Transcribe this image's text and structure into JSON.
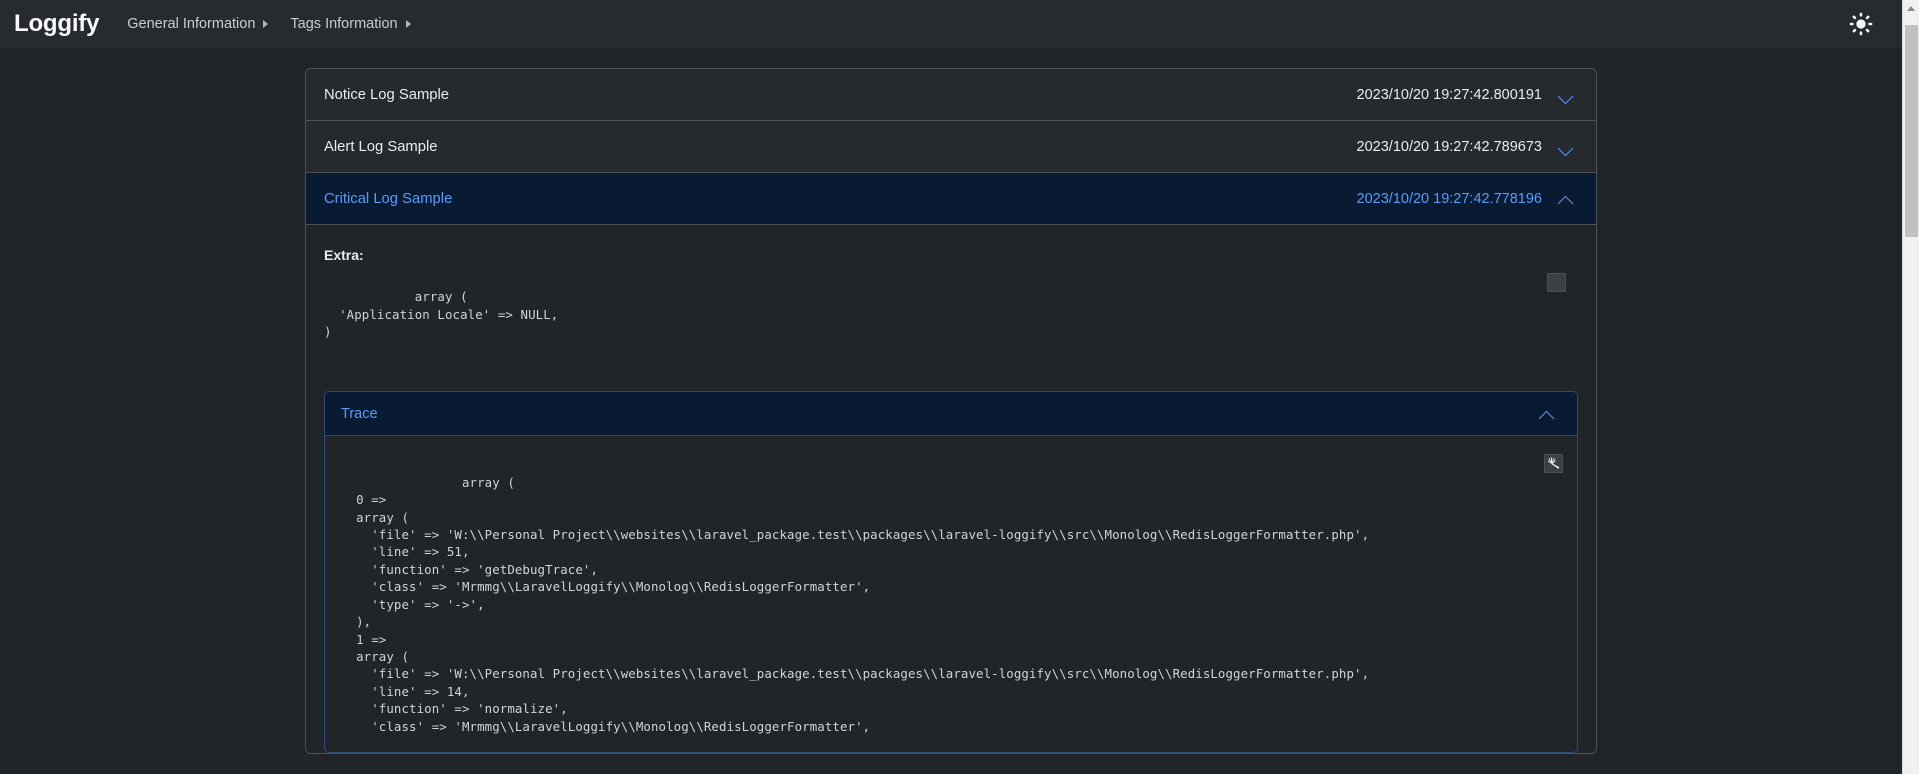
{
  "header": {
    "brand": "Loggify",
    "nav_items": [
      {
        "label": "General Information",
        "icon": "caret-right-icon"
      },
      {
        "label": "Tags Information",
        "icon": "caret-right-icon"
      }
    ],
    "theme_toggle_icon": "sun-icon"
  },
  "accordion": {
    "entries": [
      {
        "title": "Notice Log Sample",
        "timestamp": "2023/10/20 19:27:42.800191",
        "expanded": false,
        "chevron": "chevron-down-icon"
      },
      {
        "title": "Alert Log Sample",
        "timestamp": "2023/10/20 19:27:42.789673",
        "expanded": false,
        "chevron": "chevron-down-icon"
      },
      {
        "title": "Critical Log Sample",
        "timestamp": "2023/10/20 19:27:42.778196",
        "expanded": true,
        "chevron": "chevron-up-icon"
      }
    ]
  },
  "detail": {
    "extra_label": "Extra:",
    "extra_code": "array (\n  'Application Locale' => NULL,\n)",
    "extra_copy_icon": "copy-image-icon",
    "trace": {
      "title": "Trace",
      "chevron": "chevron-up-icon",
      "copy_icon": "copy-image-icon",
      "code": "array (\n  0 => \n  array (\n    'file' => 'W:\\\\Personal Project\\\\websites\\\\laravel_package.test\\\\packages\\\\laravel-loggify\\\\src\\\\Monolog\\\\RedisLoggerFormatter.php',\n    'line' => 51,\n    'function' => 'getDebugTrace',\n    'class' => 'Mrmmg\\\\LaravelLoggify\\\\Monolog\\\\RedisLoggerFormatter',\n    'type' => '->',\n  ),\n  1 => \n  array (\n    'file' => 'W:\\\\Personal Project\\\\websites\\\\laravel_package.test\\\\packages\\\\laravel-loggify\\\\src\\\\Monolog\\\\RedisLoggerFormatter.php',\n    'line' => 14,\n    'function' => 'normalize',\n    'class' => 'Mrmmg\\\\LaravelLoggify\\\\Monolog\\\\RedisLoggerFormatter',"
    }
  },
  "scrollbar": {
    "up_arrow_icon": "scroll-up-arrow-icon"
  },
  "colors": {
    "page_bg": "#212529",
    "navbar_bg": "#272b30",
    "accent_blue": "#5b9bf8",
    "active_row_bg": "#081b33",
    "border": "#4d5256"
  }
}
